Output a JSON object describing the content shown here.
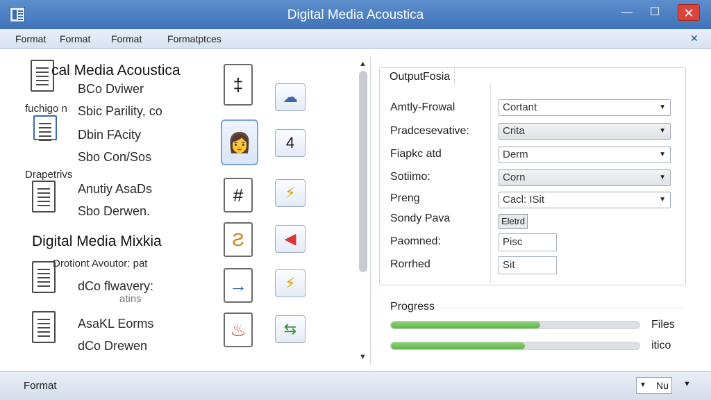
{
  "window": {
    "title": "Digital Media Acoustica",
    "minimize": "—",
    "maximize": "☐",
    "close": "✕"
  },
  "menu": {
    "items": [
      "Format",
      "Format",
      "Format",
      "Formatptces"
    ],
    "close": "✕"
  },
  "file_list": {
    "entries": [
      "cal Media Acoustica",
      "BCo Dviwer",
      "fuchigo n",
      "Sbic Parility, co",
      "Dbin FAcity",
      "Sbo Con/Sos",
      "Drapetrivs",
      "Anutiy AsaDs",
      "Sbo Derwen.",
      "Digital Media Mixkia",
      "Drotiont Avoutor: pat",
      "dCo flwavery:",
      "atins",
      "AsaKL Eorms",
      "dCo Drewen"
    ],
    "thumb_glyphs": [
      "‡",
      "☁",
      "4",
      "#",
      "⚡",
      "Ƨ",
      "◀",
      "→",
      "⚡",
      "♨",
      "⇆"
    ]
  },
  "settings": {
    "group_title": "OutputFosia",
    "labels": [
      "Amtly-Frowal",
      "Pradcesevative:",
      "Fiapkc atd",
      "Sotiimo:",
      "Preng",
      "Sondy Pava",
      "Paomned:",
      "Rorrhed"
    ],
    "dropdowns": [
      "Cortant",
      "Crita",
      "Derm",
      "Corn",
      "Cacl: ISit"
    ],
    "tag_value": "Eletrd",
    "text_values": [
      "Pisc",
      "Sit"
    ]
  },
  "progress": {
    "title": "Progress",
    "bars": [
      {
        "label": "Files",
        "value": 0.6
      },
      {
        "label": "itico",
        "value": 0.54
      }
    ]
  },
  "status": {
    "text": "Format",
    "select_value": "Nu",
    "arrow": "▼"
  },
  "colors": {
    "title_bar": "#4a7ec1",
    "progress_fill": "#6bbd52",
    "close_button": "#d9453a"
  }
}
